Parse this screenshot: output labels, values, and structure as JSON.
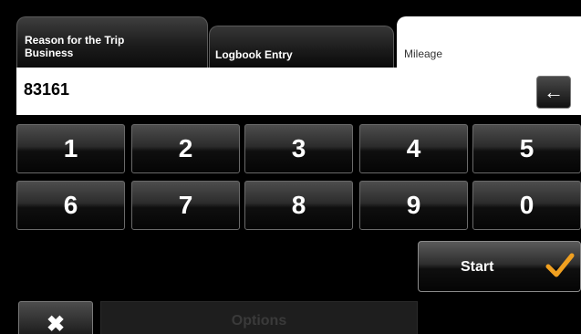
{
  "tabs": {
    "reason": {
      "line1": "Reason for the Trip",
      "line2": "Business"
    },
    "logbook": {
      "label": "Logbook Entry"
    },
    "mileage": {
      "label": "Mileage"
    }
  },
  "input": {
    "value": "83161"
  },
  "backspace": {
    "icon": "backspace-arrow-icon",
    "glyph": "←"
  },
  "keypad": {
    "row1": [
      "1",
      "2",
      "3",
      "4",
      "5"
    ],
    "row2": [
      "6",
      "7",
      "8",
      "9",
      "0"
    ]
  },
  "start": {
    "label": "Start",
    "icon": "checkmark-icon",
    "icon_color": "#f0a020"
  },
  "close": {
    "glyph": "✖",
    "icon": "close-icon"
  },
  "options": {
    "label": "Options"
  }
}
